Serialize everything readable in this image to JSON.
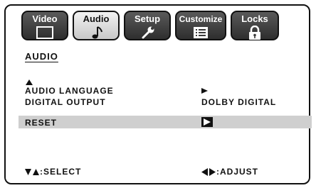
{
  "tabs": [
    {
      "label": "Video",
      "icon": "screen-icon"
    },
    {
      "label": "Audio",
      "icon": "music-note-icon",
      "active": true
    },
    {
      "label": "Setup",
      "icon": "wrench-icon"
    },
    {
      "label": "Customize",
      "icon": "list-icon"
    },
    {
      "label": "Locks",
      "icon": "padlock-icon"
    }
  ],
  "menu": {
    "title": "AUDIO",
    "items": [
      {
        "label": "AUDIO LANGUAGE",
        "value": ""
      },
      {
        "label": "DIGITAL OUTPUT",
        "value": "DOLBY DIGITAL"
      },
      {
        "label": "RESET",
        "value": ""
      }
    ],
    "highlighted_item": "RESET"
  },
  "footer": {
    "select_hint": ":SELECT",
    "adjust_hint": ":ADJUST"
  },
  "colors": {
    "tab_dark": "#3a3a3a",
    "tab_active": "#dcdcdc",
    "highlight": "#cfcfcf",
    "text": "#111111"
  }
}
